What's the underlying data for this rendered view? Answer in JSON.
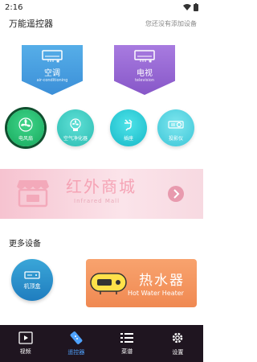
{
  "status": {
    "time": "2:16"
  },
  "header": {
    "title": "万能遥控器",
    "no_device": "您还没有添加设备"
  },
  "featured": [
    {
      "label": "空调",
      "sub": "air-conditioning"
    },
    {
      "label": "电视",
      "sub": "television"
    }
  ],
  "devices": [
    {
      "label": "电风扇"
    },
    {
      "label": "空气净化器"
    },
    {
      "label": "插座"
    },
    {
      "label": "投影仪"
    }
  ],
  "banner": {
    "title": "红外商城",
    "subtitle": "Infrared Mall"
  },
  "more": {
    "title": "更多设备",
    "stb_label": "机顶盒",
    "heater_title": "热水器",
    "heater_sub": "Hot Water Heater"
  },
  "nav": [
    {
      "label": "视频"
    },
    {
      "label": "遥控器"
    },
    {
      "label": "菜谱"
    },
    {
      "label": "设置"
    }
  ],
  "colors": {
    "accent": "#4fa3ff",
    "nav_bg": "#1f1520"
  }
}
